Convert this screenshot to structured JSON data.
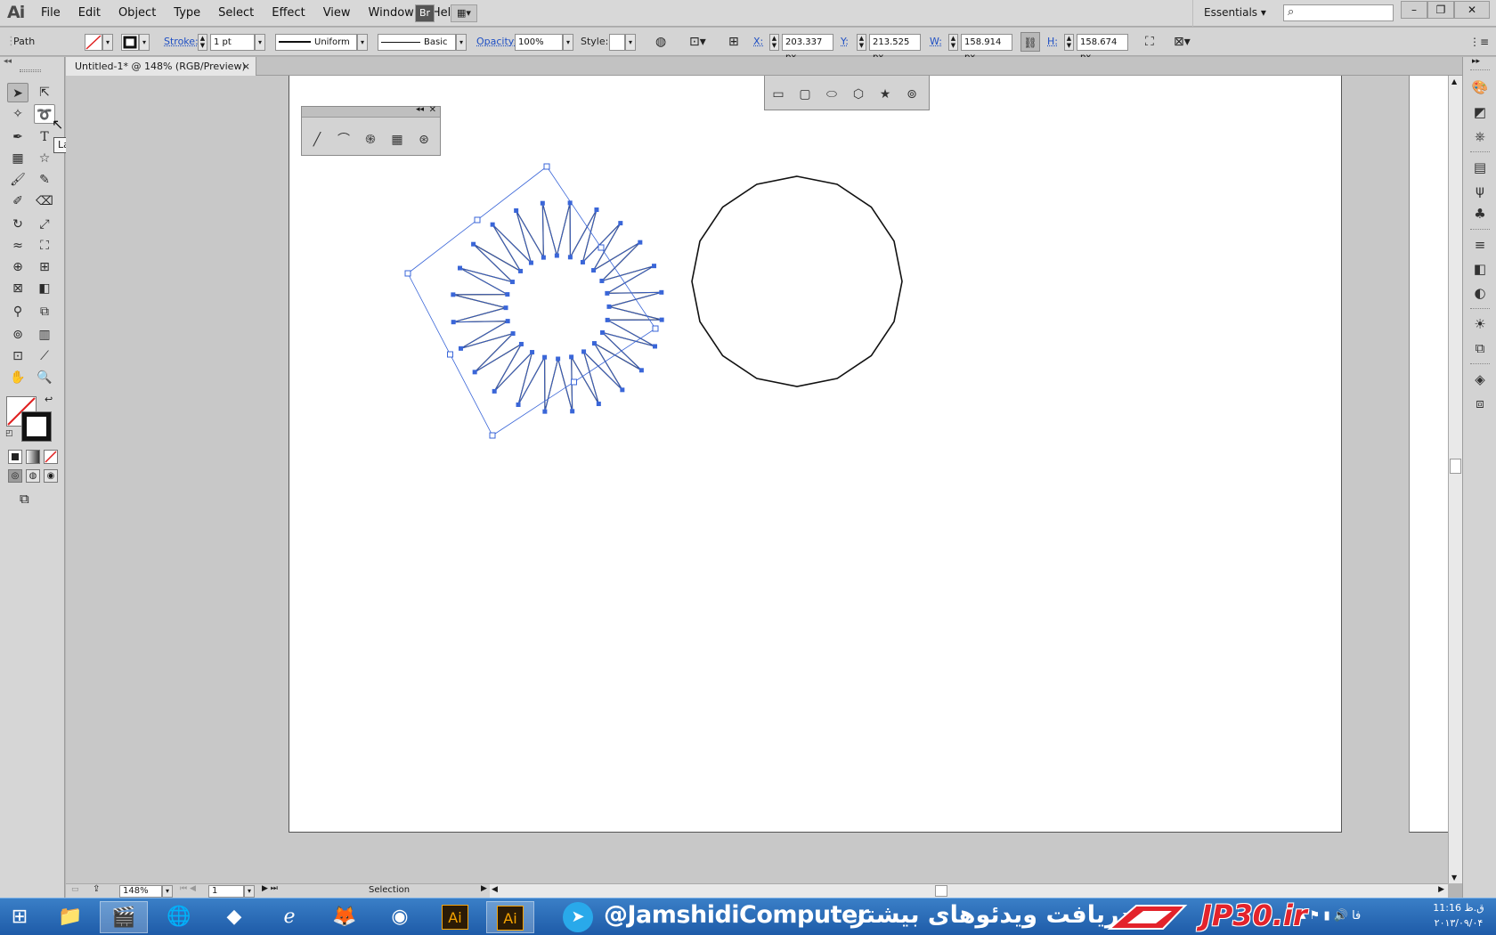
{
  "app": {
    "logo": "Ai",
    "menu": [
      "File",
      "Edit",
      "Object",
      "Type",
      "Select",
      "Effect",
      "View",
      "Window",
      "Help"
    ],
    "bridge_label": "Br",
    "arrange_label": "▦▾",
    "workspace": "Essentials",
    "search_placeholder": "",
    "window_buttons": {
      "minimize": "–",
      "restore": "❐",
      "close": "✕"
    }
  },
  "control_bar": {
    "selection_type": "Path",
    "stroke_label": "Stroke:",
    "stroke_weight": "1 pt",
    "profile": "Uniform",
    "brush": "Basic",
    "opacity_label": "Opacity:",
    "opacity": "100%",
    "style_label": "Style:",
    "x_label": "X:",
    "x": "203.337 px",
    "y_label": "Y:",
    "y": "213.525 px",
    "w_label": "W:",
    "w": "158.914 px",
    "h_label": "H:",
    "h": "158.674 px"
  },
  "document": {
    "tab_title": "Untitled-1* @ 148% (RGB/Preview)",
    "tab_close": "×"
  },
  "tools": {
    "tooltip": "Lasso Tool (Q)"
  },
  "status_bar": {
    "zoom": "148%",
    "artboard": "1",
    "status": "Selection"
  },
  "taskbar": {
    "banner_handle": "@JamshidiComputer",
    "banner_fa": "دریافت ویدئوهای بیشتر",
    "banner_site": "JP30.ir",
    "time": "11:16 ق.ظ",
    "date": "۲۰۱۳/۰۹/۰۴",
    "lang": "فا"
  },
  "colors": {
    "selection": "#3a66d8",
    "chrome": "#d6d6d6",
    "taskbar": "#2a6cb8"
  }
}
